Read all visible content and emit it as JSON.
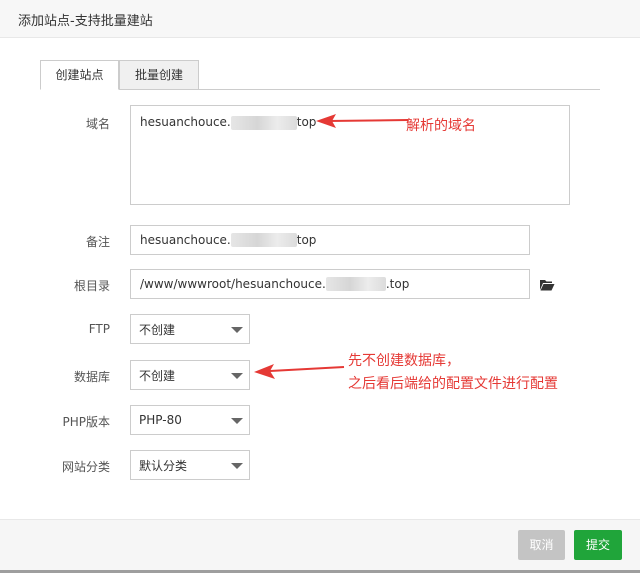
{
  "window": {
    "title": "添加站点-支持批量建站"
  },
  "tabs": [
    {
      "label": "创建站点",
      "active": true
    },
    {
      "label": "批量创建",
      "active": false
    }
  ],
  "form": {
    "domain": {
      "label": "域名",
      "value_prefix": "hesuanchouce.",
      "value_suffix": "top"
    },
    "remark": {
      "label": "备注",
      "value_prefix": "hesuanchouce.",
      "value_suffix": "top"
    },
    "root": {
      "label": "根目录",
      "value_prefix": "/www/wwwroot/hesuanchouce.",
      "value_suffix": ".top",
      "icon": "folder-open-icon"
    },
    "ftp": {
      "label": "FTP",
      "selected": "不创建"
    },
    "database": {
      "label": "数据库",
      "selected": "不创建"
    },
    "php": {
      "label": "PHP版本",
      "selected": "PHP-80"
    },
    "category": {
      "label": "网站分类",
      "selected": "默认分类"
    }
  },
  "annotations": {
    "domain_note": "解析的域名",
    "db_note_line1": "先不创建数据库，",
    "db_note_line2": "之后看后端给的配置文件进行配置",
    "color": "#e53935"
  },
  "footer": {
    "cancel_label": "取消",
    "submit_label": "提交"
  },
  "colors": {
    "primary": "#20a53a",
    "disabled": "#c4c4c4"
  }
}
